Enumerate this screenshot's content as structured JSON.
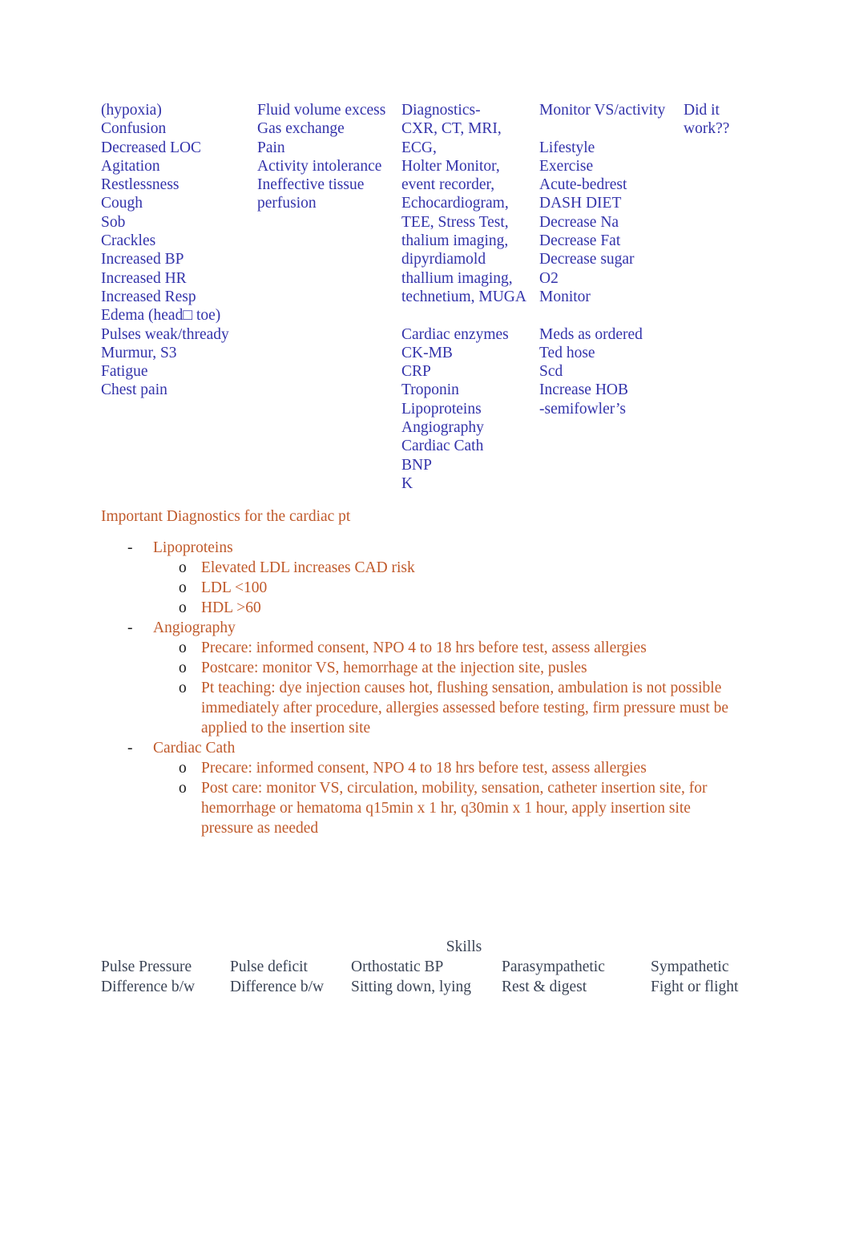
{
  "colors": {
    "assessment_blue": "#3333AA",
    "diagnostics_orange": "#C05A2B",
    "skills_slate": "#3B4456",
    "marker_black": "#1A1A1A",
    "page_background": "#FFFFFF"
  },
  "columns": [
    {
      "name": "assessment-column",
      "lines": [
        "(hypoxia)",
        "Confusion",
        "Decreased LOC",
        "Agitation",
        "Restlessness",
        "Cough",
        "Sob",
        "Crackles",
        "Increased BP",
        "Increased HR",
        "Increased Resp",
        "Edema (head□ toe)",
        "Pulses weak/thready",
        "Murmur, S3",
        "Fatigue",
        "Chest pain"
      ]
    },
    {
      "name": "nursing-diagnosis-column",
      "lines": [
        "Fluid volume excess",
        "Gas exchange",
        "Pain",
        "Activity intolerance",
        "Ineffective tissue",
        "perfusion"
      ]
    },
    {
      "name": "diagnostics-column",
      "lines": [
        "Diagnostics-",
        "CXR, CT, MRI, ECG,",
        "Holter Monitor,",
        "event recorder,",
        "Echocardiogram,",
        "TEE, Stress Test,",
        "thalium imaging,",
        "dipyrdiamold",
        "thallium imaging,",
        "technetium, MUGA",
        "",
        "Cardiac enzymes",
        "CK-MB",
        "CRP",
        "Troponin",
        "Lipoproteins",
        "Angiography",
        "Cardiac Cath",
        "BNP",
        "K"
      ]
    },
    {
      "name": "interventions-column",
      "lines": [
        "Monitor VS/activity",
        "",
        "Lifestyle",
        "Exercise",
        "Acute-bedrest",
        "DASH DIET",
        "Decrease Na",
        "Decrease Fat",
        "Decrease sugar",
        "O2",
        "Monitor",
        "",
        "Meds as ordered",
        "Ted hose",
        "Scd",
        "Increase HOB",
        "-semifowler’s"
      ]
    },
    {
      "name": "evaluation-column",
      "lines": [
        "Did it",
        "work??"
      ]
    }
  ],
  "diagnostics_section": {
    "heading": "Important Diagnostics for the cardiac pt",
    "dash_marker": "-",
    "circle_marker": "o",
    "items": [
      {
        "label": "Lipoproteins",
        "subitems": [
          "Elevated LDL increases CAD risk",
          "LDL <100",
          "HDL >60"
        ]
      },
      {
        "label": "Angiography",
        "subitems": [
          "Precare: informed consent, NPO 4 to 18 hrs before test, assess allergies",
          "Postcare: monitor VS, hemorrhage at the injection site, pusles",
          "Pt teaching: dye injection causes hot, flushing sensation, ambulation is not possible immediately after procedure, allergies assessed before testing, firm pressure must be applied to the insertion site"
        ]
      },
      {
        "label": "Cardiac Cath",
        "subitems": [
          "Precare: informed consent, NPO 4 to 18 hrs before test, assess allergies",
          "Post care: monitor VS, circulation, mobility, sensation, catheter insertion site, for hemorrhage or hematoma q15min x 1 hr, q30min x 1 hour, apply insertion site pressure as needed"
        ]
      }
    ]
  },
  "skills_section": {
    "title": "Skills",
    "row1": [
      "Pulse Pressure",
      "Pulse deficit",
      "Orthostatic BP",
      "Parasympathetic",
      "Sympathetic"
    ],
    "row2": [
      "Difference b/w",
      "Difference b/w",
      "Sitting down, lying",
      "Rest & digest",
      "Fight or flight"
    ]
  }
}
